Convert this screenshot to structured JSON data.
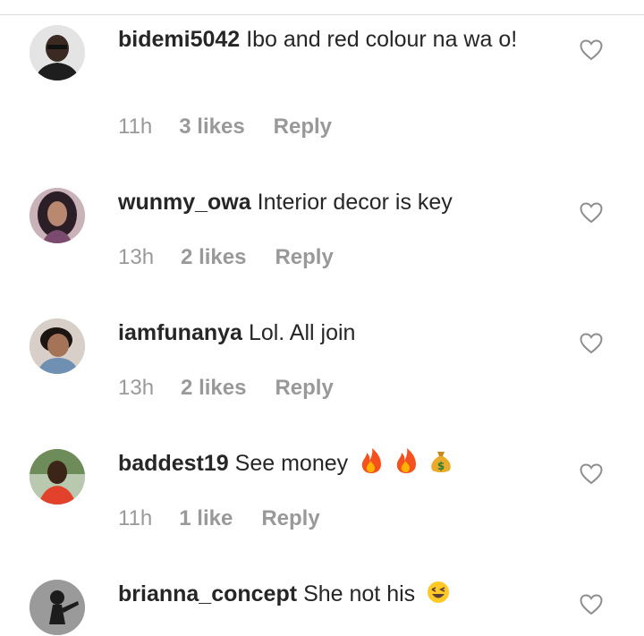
{
  "colors": {
    "text": "#262626",
    "meta": "#999999",
    "divider": "#dbdbdb"
  },
  "icons": {
    "like": "heart-outline-icon",
    "fire": "fire-emoji",
    "money": "money-bag-emoji",
    "laugh": "winking-laugh-emoji"
  },
  "comments": [
    {
      "username": "bidemi5042",
      "text": "Ibo and red colour na wa o!",
      "time": "11h",
      "likes": "3 likes",
      "reply": "Reply"
    },
    {
      "username": "wunmy_owa",
      "text": "Interior decor is key",
      "time": "13h",
      "likes": "2 likes",
      "reply": "Reply"
    },
    {
      "username": "iamfunanya",
      "text": "Lol. All join",
      "time": "13h",
      "likes": "2 likes",
      "reply": "Reply"
    },
    {
      "username": "baddest19",
      "text": "See money",
      "time": "11h",
      "likes": "1 like",
      "reply": "Reply"
    },
    {
      "username": "brianna_concept",
      "text": "She not his",
      "time": "",
      "likes": "",
      "reply": ""
    }
  ]
}
